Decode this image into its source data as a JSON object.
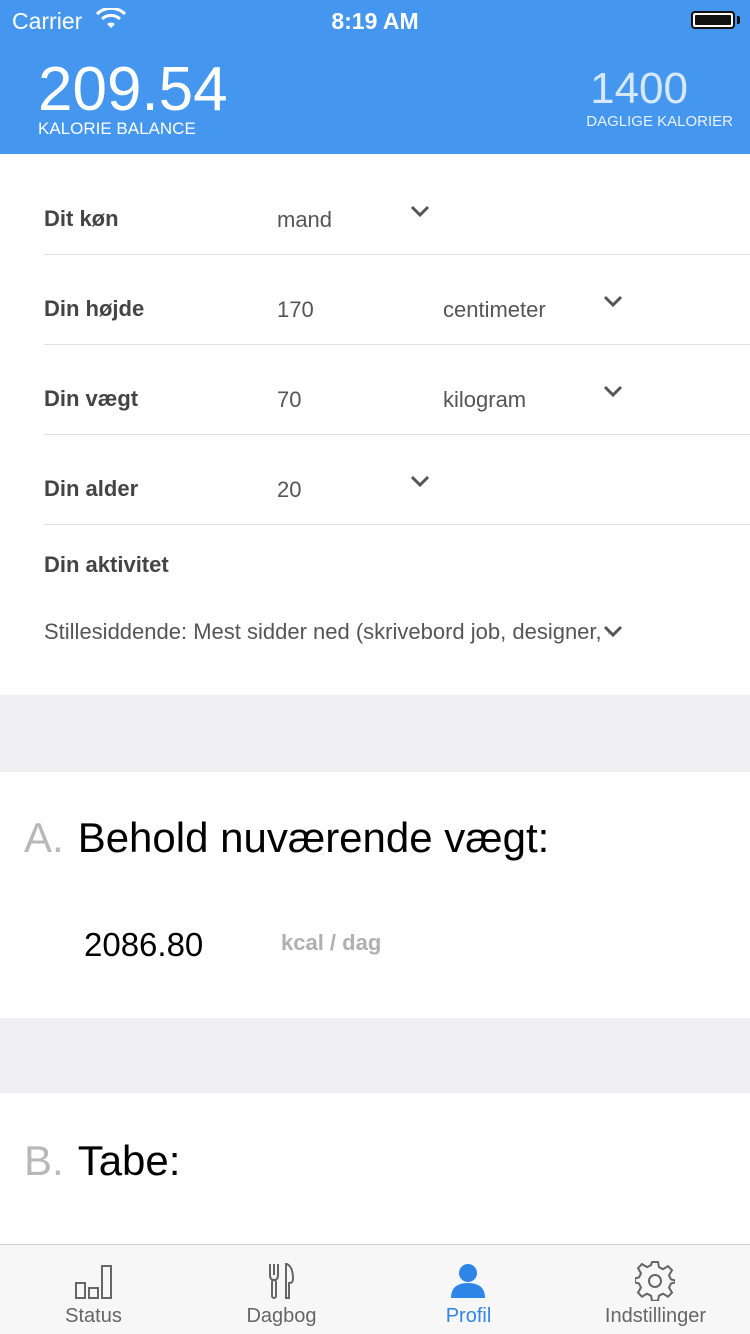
{
  "status_bar": {
    "carrier": "Carrier",
    "time": "8:19 AM"
  },
  "header": {
    "balance_value": "209.54",
    "balance_label": "KALORIE BALANCE",
    "daily_value": "1400",
    "daily_label": "DAGLIGE KALORIER",
    "background_color": "#4496ee"
  },
  "profile": {
    "gender": {
      "label": "Dit køn",
      "value": "mand"
    },
    "height": {
      "label": "Din højde",
      "value": "170",
      "unit": "centimeter"
    },
    "weight": {
      "label": "Din vægt",
      "value": "70",
      "unit": "kilogram"
    },
    "age": {
      "label": "Din alder",
      "value": "20"
    },
    "activity": {
      "label": "Din aktivitet",
      "value": "Stillesiddende: Mest sidder ned (skrivebord job, designer, osv.)"
    }
  },
  "sections": {
    "a": {
      "letter": "A.",
      "title": "Behold nuværende vægt:",
      "kcal_value": "2086.80",
      "kcal_unit": "kcal / dag"
    },
    "b": {
      "letter": "B.",
      "title": "Tabe:"
    }
  },
  "tabbar": {
    "active_color": "#2f86e6",
    "tabs": [
      {
        "label": "Status",
        "icon": "bar-chart-icon"
      },
      {
        "label": "Dagbog",
        "icon": "fork-knife-icon"
      },
      {
        "label": "Profil",
        "icon": "person-icon",
        "active": true
      },
      {
        "label": "Indstillinger",
        "icon": "gear-icon"
      }
    ]
  }
}
